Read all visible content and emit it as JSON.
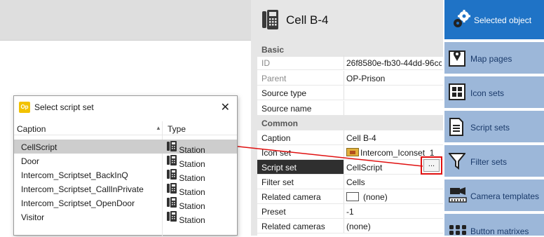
{
  "header": {
    "title": "Cell B-4"
  },
  "properties": [
    {
      "type": "category",
      "key": "Basic"
    },
    {
      "key": "ID",
      "value": "26f8580e-fb30-44dd-96cc-",
      "muted": true
    },
    {
      "key": "Parent",
      "value": "OP-Prison",
      "muted": true
    },
    {
      "key": "Source type",
      "value": ""
    },
    {
      "key": "Source name",
      "value": ""
    },
    {
      "type": "category",
      "key": "Common"
    },
    {
      "key": "Caption",
      "value": "Cell B-4"
    },
    {
      "key": "Icon set",
      "value": "Intercom_Iconset_1",
      "icon": true
    },
    {
      "key": "Script set",
      "value": "CellScript",
      "selected": true
    },
    {
      "key": "Filter set",
      "value": "Cells"
    },
    {
      "key": "Related camera",
      "value": "(none)",
      "swatch": true
    },
    {
      "key": "Preset",
      "value": "-1"
    },
    {
      "key": "Related cameras",
      "value": "(none)"
    }
  ],
  "ellipsis_label": "...",
  "nav": [
    {
      "label": "Selected object",
      "icon": "gears-icon",
      "active": true
    },
    {
      "label": "Map pages",
      "icon": "map-pin-icon"
    },
    {
      "label": "Icon sets",
      "icon": "icon-set-icon"
    },
    {
      "label": "Script sets",
      "icon": "document-icon"
    },
    {
      "label": "Filter sets",
      "icon": "funnel-icon"
    },
    {
      "label": "Camera templates",
      "icon": "camera-icon"
    },
    {
      "label": "Button matrixes",
      "icon": "button-grid-icon"
    }
  ],
  "dialog": {
    "logo": "Op",
    "title": "Select script set",
    "close": "✕",
    "col_caption": "Caption",
    "col_type": "Type",
    "sort_indicator": "▲",
    "items": [
      {
        "caption": "CellScript",
        "type": "Station",
        "selected": true
      },
      {
        "caption": "Door",
        "type": "Station"
      },
      {
        "caption": "Intercom_Scriptset_BackInQ",
        "type": "Station"
      },
      {
        "caption": "Intercom_Scriptset_CallInPrivate",
        "type": "Station"
      },
      {
        "caption": "Intercom_Scriptset_OpenDoor",
        "type": "Station"
      },
      {
        "caption": "Visitor",
        "type": "Station"
      }
    ]
  },
  "colors": {
    "accent": "#1f73c6",
    "nav_inactive": "#9cb7d9",
    "annotation": "#e01010"
  }
}
